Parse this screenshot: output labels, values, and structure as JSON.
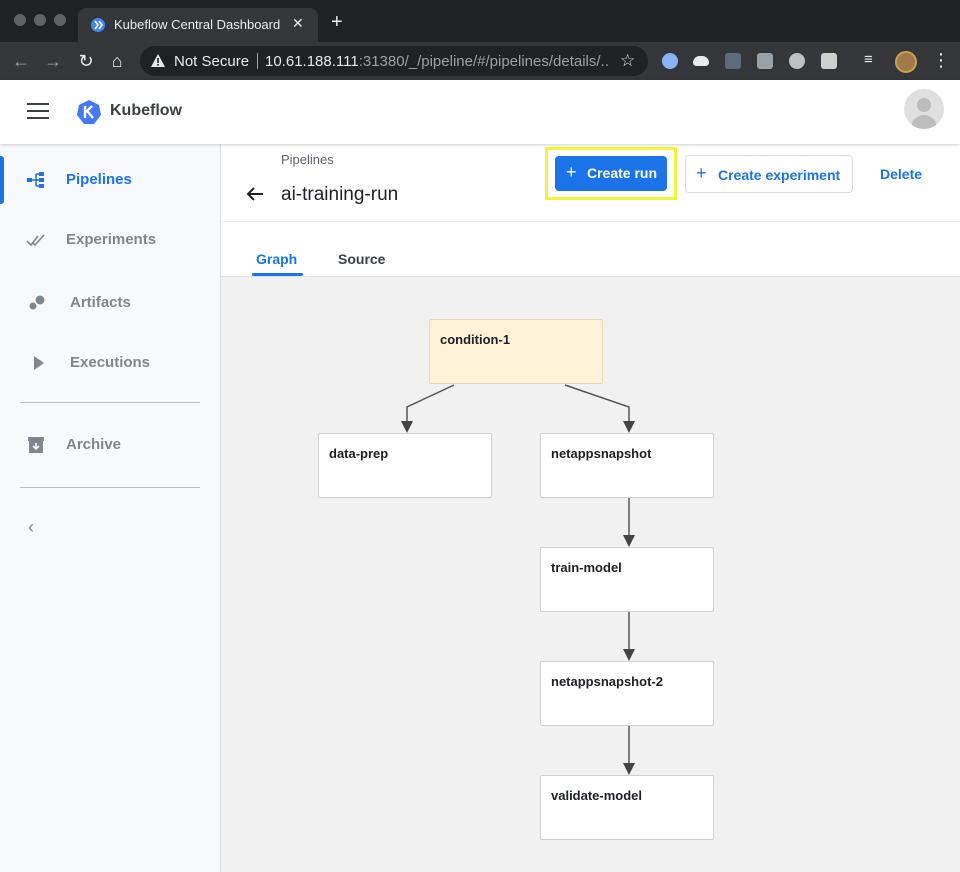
{
  "browser": {
    "tab_title": "Kubeflow Central Dashboard",
    "not_secure_label": "Not Secure",
    "url_host": "10.61.188.111",
    "url_rest": ":31380/_/pipeline/#/pipelines/details/..."
  },
  "header": {
    "app_name": "Kubeflow"
  },
  "sidebar": {
    "items": [
      {
        "label": "Pipelines",
        "icon": "pipelines-icon",
        "active": true
      },
      {
        "label": "Experiments",
        "icon": "experiments-icon",
        "active": false
      },
      {
        "label": "Artifacts",
        "icon": "artifacts-icon",
        "active": false
      },
      {
        "label": "Executions",
        "icon": "executions-icon",
        "active": false
      },
      {
        "label": "Archive",
        "icon": "archive-icon",
        "active": false
      }
    ]
  },
  "page": {
    "breadcrumb": "Pipelines",
    "title": "ai-training-run",
    "create_run_label": "Create run",
    "create_experiment_label": "Create experiment",
    "delete_label": "Delete"
  },
  "tabs": [
    {
      "label": "Graph",
      "active": true
    },
    {
      "label": "Source",
      "active": false
    }
  ],
  "colors": {
    "accent": "#1a73e8",
    "highlight": "#f5f23a",
    "condition_node": "#fef3d8"
  },
  "graph": {
    "nodes": [
      {
        "id": "condition-1",
        "label": "condition-1"
      },
      {
        "id": "data-prep",
        "label": "data-prep"
      },
      {
        "id": "netappsnapshot",
        "label": "netappsnapshot"
      },
      {
        "id": "train-model",
        "label": "train-model"
      },
      {
        "id": "netappsnapshot-2",
        "label": "netappsnapshot-2"
      },
      {
        "id": "validate-model",
        "label": "validate-model"
      }
    ],
    "edges": [
      [
        "condition-1",
        "data-prep"
      ],
      [
        "condition-1",
        "netappsnapshot"
      ],
      [
        "netappsnapshot",
        "train-model"
      ],
      [
        "train-model",
        "netappsnapshot-2"
      ],
      [
        "netappsnapshot-2",
        "validate-model"
      ]
    ]
  }
}
